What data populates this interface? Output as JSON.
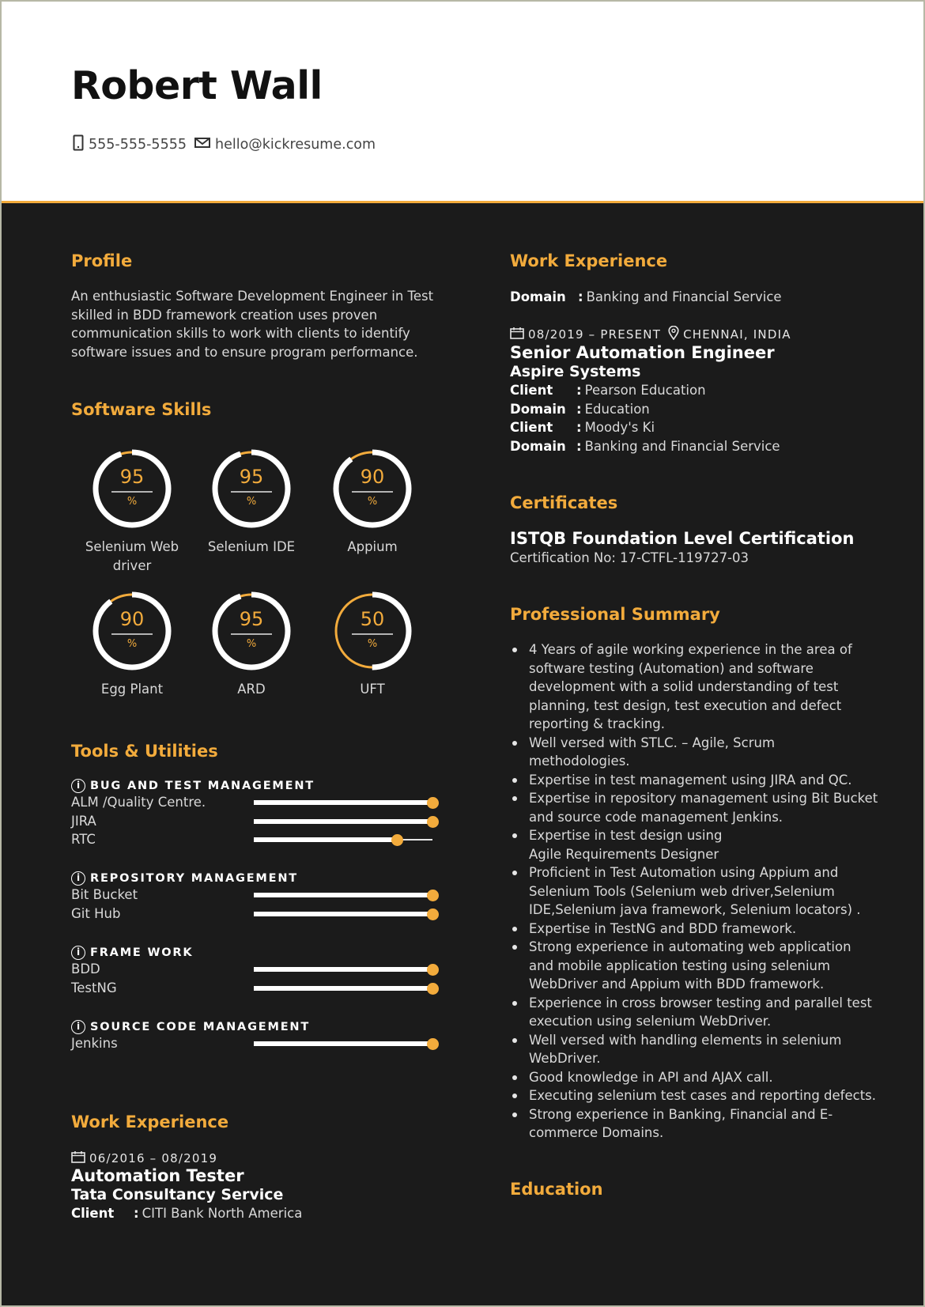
{
  "header": {
    "name": "Robert Wall",
    "phone": "555-555-5555",
    "email": "hello@kickresume.com",
    "phone_icon": "mobile-phone-icon",
    "email_icon": "envelope-icon"
  },
  "colors": {
    "accent": "#f2ab3c",
    "background": "#1b1b1b",
    "header_bg": "#ffffff",
    "text": "#d9d9d9"
  },
  "profile": {
    "heading": "Profile",
    "lines": [
      "An enthusiastic Software Development Engineer in Test",
      "skilled in BDD framework creation uses proven",
      "communication skills to work with clients to identify",
      "software issues and to ensure program performance."
    ]
  },
  "software_skills": {
    "heading": "Software Skills",
    "percent_sign": "%",
    "items": [
      {
        "name": "Selenium Web driver",
        "label_lines": [
          "Selenium Web",
          "driver"
        ],
        "value": "95",
        "percent": 95
      },
      {
        "name": "Selenium IDE",
        "label_lines": [
          "Selenium IDE"
        ],
        "value": "95",
        "percent": 95
      },
      {
        "name": "Appium",
        "label_lines": [
          "Appium"
        ],
        "value": "90",
        "percent": 90
      },
      {
        "name": "Egg Plant",
        "label_lines": [
          "Egg Plant"
        ],
        "value": "90",
        "percent": 90
      },
      {
        "name": "ARD",
        "label_lines": [
          "ARD"
        ],
        "value": "95",
        "percent": 95
      },
      {
        "name": "UFT",
        "label_lines": [
          "UFT"
        ],
        "value": "50",
        "percent": 50
      }
    ]
  },
  "tools": {
    "heading": "Tools & Utilities",
    "info_icon": "info-icon",
    "info_glyph": "i",
    "groups": [
      {
        "title": "BUG AND TEST MANAGEMENT",
        "items": [
          {
            "name": "ALM /Quality Centre.",
            "level": 1.0
          },
          {
            "name": "JIRA",
            "level": 1.0
          },
          {
            "name": "RTC",
            "level": 0.8
          }
        ]
      },
      {
        "title": "REPOSITORY MANAGEMENT",
        "items": [
          {
            "name": "Bit Bucket",
            "level": 1.0
          },
          {
            "name": "Git Hub",
            "level": 1.0
          }
        ]
      },
      {
        "title": "FRAME WORK",
        "items": [
          {
            "name": "BDD",
            "level": 1.0
          },
          {
            "name": "TestNG",
            "level": 1.0
          }
        ]
      },
      {
        "title": "SOURCE CODE MANAGEMENT",
        "items": [
          {
            "name": "Jenkins",
            "level": 1.0
          }
        ]
      }
    ]
  },
  "work_left": {
    "heading": "Work Experience",
    "calendar_icon": "calendar-icon",
    "dates": "06/2016 – 08/2019",
    "title": "Automation Tester",
    "company": "Tata Consultancy Service",
    "details": [
      {
        "key": "Client",
        "sep": ":",
        "value": "CITI Bank North America"
      }
    ]
  },
  "work_right": {
    "heading": "Work Experience",
    "domain": {
      "key": "Domain",
      "sep": ":",
      "value": "Banking and Financial Service"
    },
    "dates": "08/2019 – PRESENT",
    "location": "CHENNAI, INDIA",
    "calendar_icon": "calendar-icon",
    "location_icon": "map-pin-icon",
    "title": "Senior Automation Engineer",
    "company": "Aspire Systems",
    "details": [
      {
        "key": "Client",
        "sep": ":",
        "value": "Pearson Education"
      },
      {
        "key": "Domain",
        "sep": ":",
        "value": "Education"
      },
      {
        "key": "Client",
        "sep": ":",
        "value": "Moody's Ki"
      },
      {
        "key": "Domain",
        "sep": ":",
        "value": "Banking and Financial Service"
      }
    ]
  },
  "certificates": {
    "heading": "Certificates",
    "name": "ISTQB Foundation Level Certification",
    "number": "Certification No: 17-CTFL-119727-03"
  },
  "summary": {
    "heading": "Professional Summary",
    "items": [
      [
        "4 Years of agile working experience in the area of",
        "software testing (Automation) and software",
        "development with a solid understanding of test",
        "planning, test design, test execution and defect",
        "reporting & tracking."
      ],
      [
        "Well versed with STLC. – Agile, Scrum",
        "methodologies."
      ],
      [
        "Expertise in test management using JIRA and QC."
      ],
      [
        "Expertise in repository management using Bit Bucket",
        "and source code management Jenkins."
      ],
      [
        "Expertise in test design using",
        "Agile Requirements Designer"
      ],
      [
        "Proficient in Test Automation using Appium and",
        "Selenium Tools (Selenium web driver,Selenium",
        "IDE,Selenium java framework, Selenium locators) ."
      ],
      [
        "Expertise in TestNG and BDD framework."
      ],
      [
        "Strong experience in automating web application",
        "and mobile application testing using selenium",
        "WebDriver and Appium with BDD framework."
      ],
      [
        "Experience in cross browser testing and parallel test",
        "execution using selenium WebDriver."
      ],
      [
        "Well versed with handling elements in selenium",
        "WebDriver."
      ],
      [
        "Good knowledge in API and AJAX call."
      ],
      [
        "Executing selenium test cases and reporting defects."
      ],
      [
        "Strong experience in Banking, Financial and E-",
        "commerce Domains."
      ]
    ]
  },
  "education": {
    "heading": "Education"
  }
}
